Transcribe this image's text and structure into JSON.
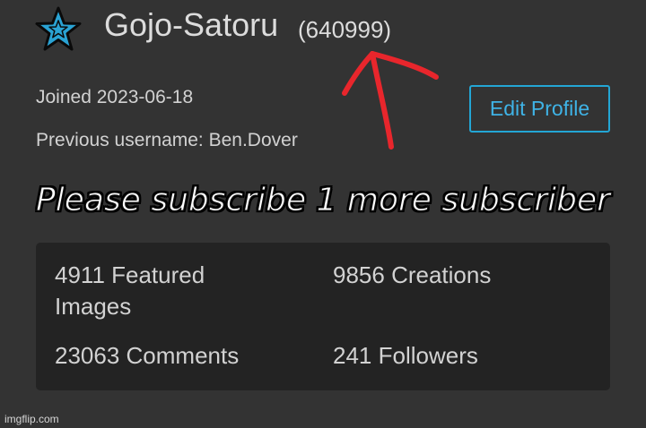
{
  "profile": {
    "username": "Gojo-Satoru",
    "points": "(640999)",
    "joined": "Joined 2023-06-18",
    "previous_username": "Previous username: Ben.Dover",
    "edit_profile_label": "Edit Profile",
    "avatar_icon": "star-icon"
  },
  "caption": "Please subscribe 1 more subscriber",
  "stats": {
    "featured_images": "4911 Featured Images",
    "creations": "9856 Creations",
    "comments": "23063 Comments",
    "followers": "241 Followers"
  },
  "watermark": "imgflip.com",
  "colors": {
    "background": "#333333",
    "panel": "#232323",
    "accent": "#3fb3e6",
    "arrow": "#e8262c"
  }
}
